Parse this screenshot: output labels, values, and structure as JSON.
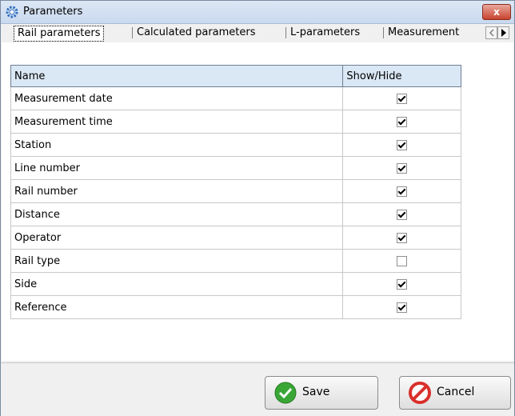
{
  "window": {
    "title": "Parameters",
    "close_label": "x"
  },
  "tabs": [
    {
      "label": "Rail parameters",
      "active": true
    },
    {
      "label": "Calculated parameters",
      "active": false
    },
    {
      "label": "L-parameters",
      "active": false
    },
    {
      "label": "Measurement",
      "active": false
    }
  ],
  "table": {
    "columns": [
      "Name",
      "Show/Hide"
    ],
    "rows": [
      {
        "name": "Measurement date",
        "shown": true
      },
      {
        "name": "Measurement time",
        "shown": true
      },
      {
        "name": "Station",
        "shown": true
      },
      {
        "name": "Line number",
        "shown": true
      },
      {
        "name": "Rail number",
        "shown": true
      },
      {
        "name": "Distance",
        "shown": true
      },
      {
        "name": "Operator",
        "shown": true
      },
      {
        "name": "Rail type",
        "shown": false
      },
      {
        "name": "Side",
        "shown": true
      },
      {
        "name": "Reference",
        "shown": true
      }
    ]
  },
  "footer": {
    "save_label": "Save",
    "cancel_label": "Cancel"
  },
  "icons": {
    "title": "gear-icon",
    "save": "check-circle-icon",
    "cancel": "forbidden-icon",
    "tab_scroll_left": "chevron-left-icon",
    "tab_scroll_right": "chevron-right-icon"
  },
  "colors": {
    "header_bg": "#dae7f4",
    "close_button": "#c9442f",
    "save_icon": "#3aa635",
    "cancel_icon": "#d9302c"
  }
}
